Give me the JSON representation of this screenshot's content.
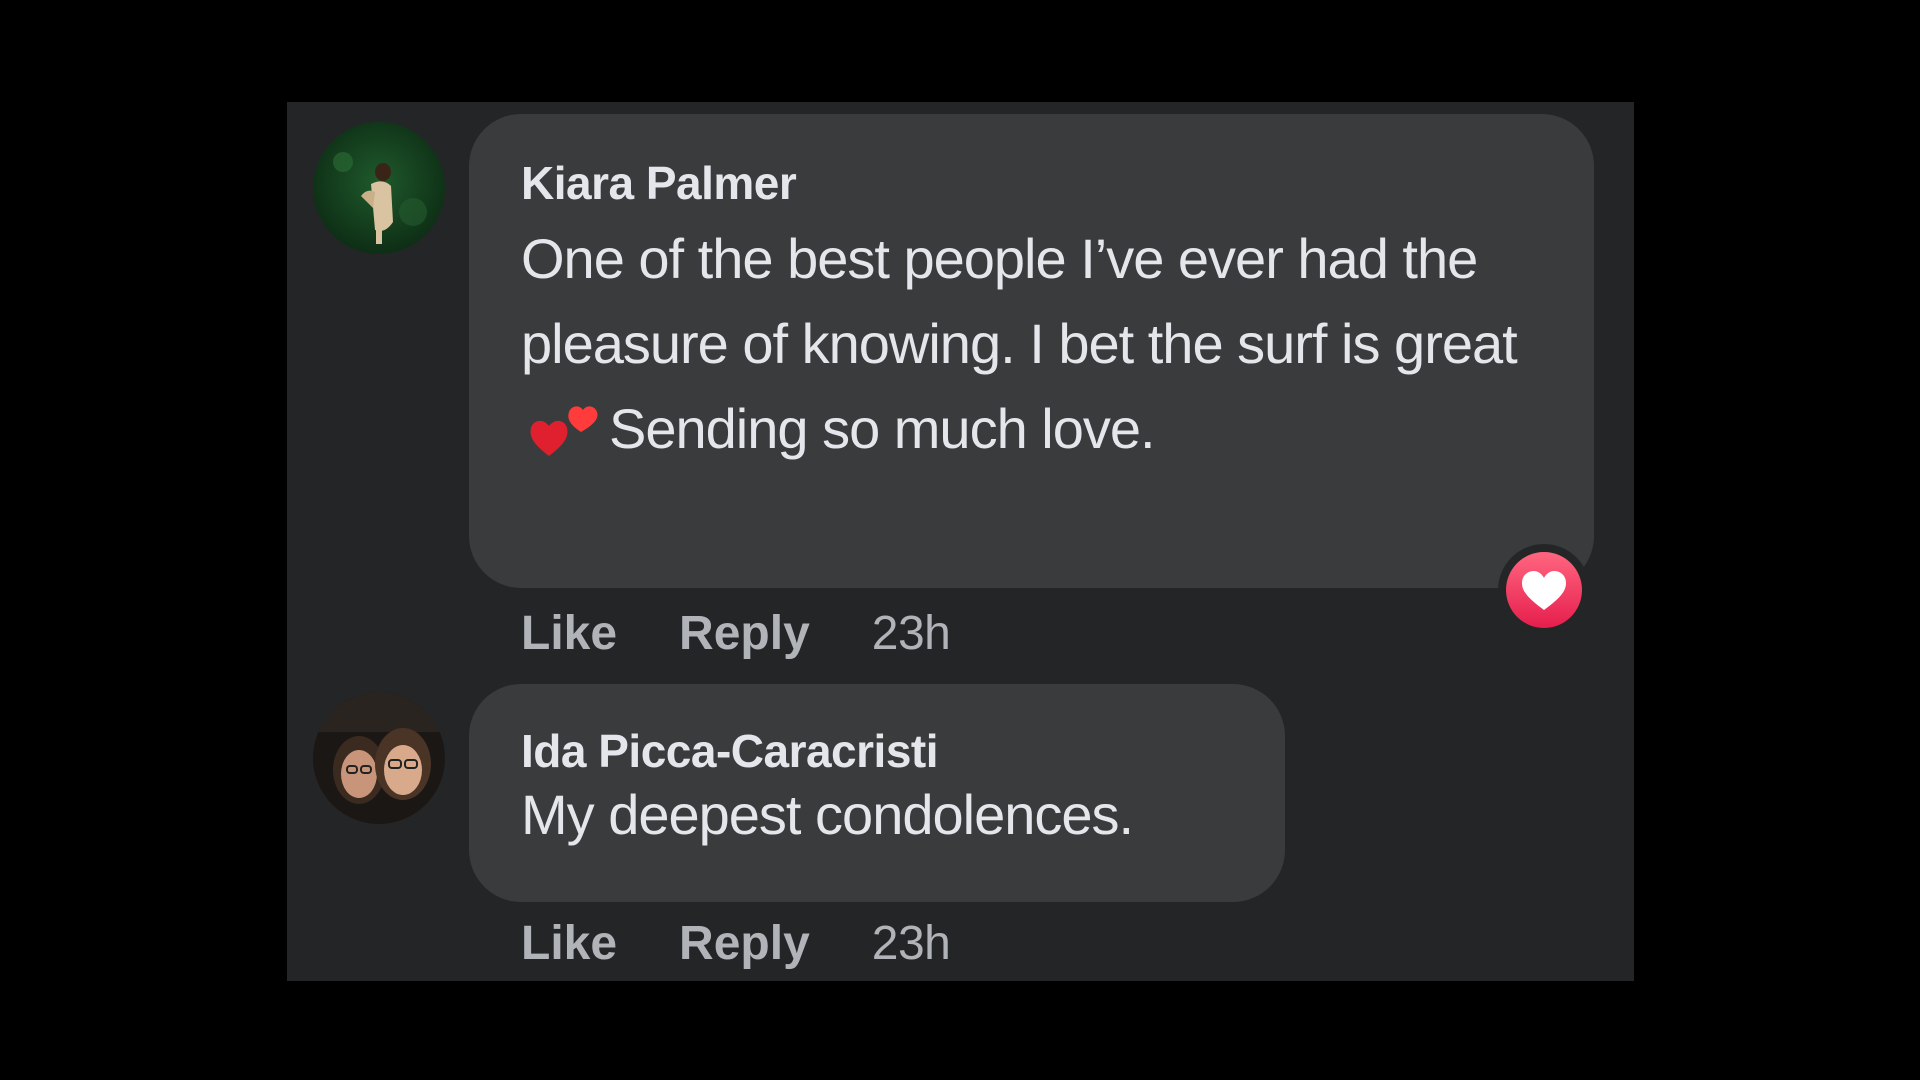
{
  "comments": [
    {
      "author": "Kiara Palmer",
      "text_before_emoji": "One of the best people I’ve ever had the pleasure of knowing. I bet the surf is great",
      "emoji": "two-hearts-emoji",
      "text_after_emoji": "Sending so much love.",
      "like_label": "Like",
      "reply_label": "Reply",
      "time": "23h",
      "reaction": "love-reaction-icon"
    },
    {
      "author": "Ida Picca-Caracristi",
      "text": "My deepest condolences.",
      "like_label": "Like",
      "reply_label": "Reply",
      "time": "23h"
    }
  ],
  "colors": {
    "page_background": "#000000",
    "panel_background": "#242526",
    "bubble_background": "#3a3b3c",
    "primary_text": "#e4e6eb",
    "secondary_text": "#b0b3b8",
    "love_reaction": "#f33e58"
  }
}
